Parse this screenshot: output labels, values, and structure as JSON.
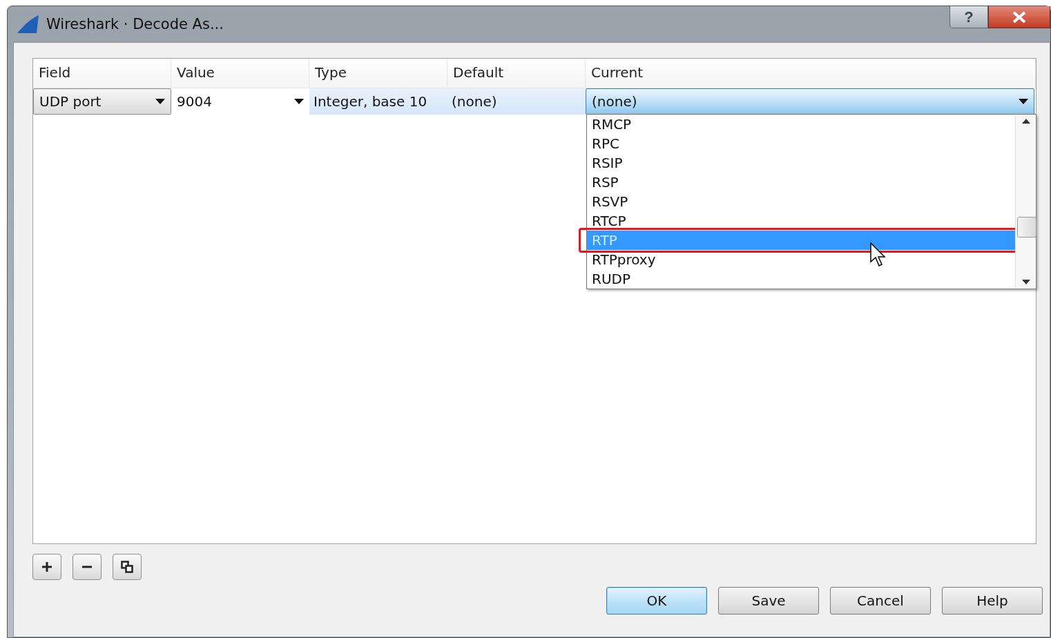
{
  "window": {
    "title": "Wireshark · Decode As...",
    "help_button": "?"
  },
  "table": {
    "columns": [
      "Field",
      "Value",
      "Type",
      "Default",
      "Current"
    ],
    "row": {
      "field": "UDP port",
      "value": "9004",
      "type": "Integer, base 10",
      "default": "(none)",
      "current": "(none)"
    }
  },
  "dropdown": {
    "items": [
      {
        "label": "RMCP",
        "selected": false
      },
      {
        "label": "RPC",
        "selected": false
      },
      {
        "label": "RSIP",
        "selected": false
      },
      {
        "label": "RSP",
        "selected": false
      },
      {
        "label": "RSVP",
        "selected": false
      },
      {
        "label": "RTCP",
        "selected": false
      },
      {
        "label": "RTP",
        "selected": true
      },
      {
        "label": "RTPproxy",
        "selected": false
      },
      {
        "label": "RUDP",
        "selected": false
      }
    ]
  },
  "buttons": [
    {
      "label": "OK",
      "default": true
    },
    {
      "label": "Save",
      "default": false
    },
    {
      "label": "Cancel",
      "default": false
    },
    {
      "label": "Help",
      "default": false
    }
  ]
}
